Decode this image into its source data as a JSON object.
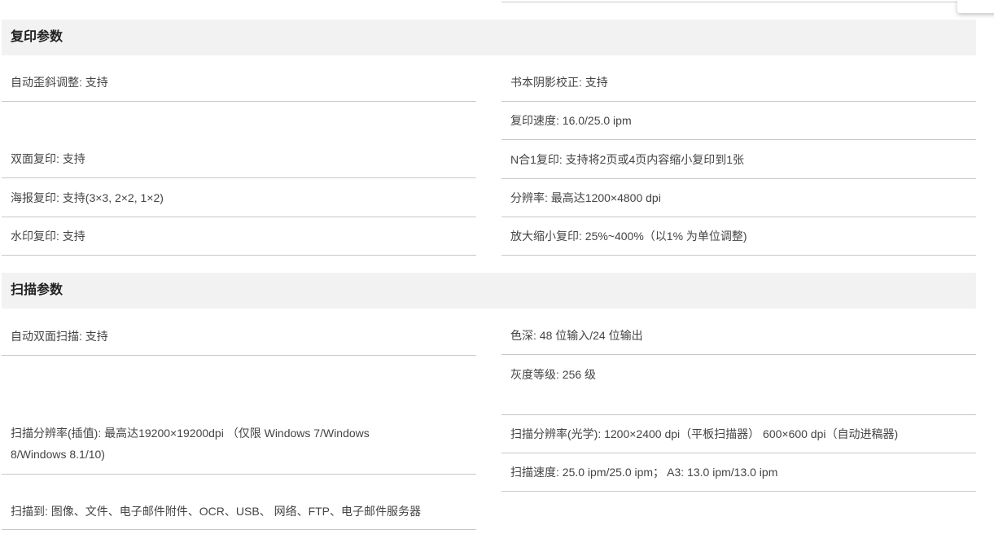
{
  "copy_section": {
    "title": "复印参数",
    "left": [
      "自动歪斜调整: 支持",
      "双面复印: 支持",
      "海报复印: 支持(3×3, 2×2, 1×2)",
      "水印复印: 支持"
    ],
    "right": [
      "书本阴影校正: 支持",
      "复印速度: 16.0/25.0 ipm",
      "N合1复印: 支持将2页或4页内容缩小复印到1张",
      "分辨率: 最高达1200×4800 dpi",
      "放大缩小复印: 25%~400%（以1% 为单位调整)"
    ]
  },
  "scan_section": {
    "title": "扫描参数",
    "left": [
      "自动双面扫描: 支持",
      "扫描分辨率(插值): 最高达19200×19200dpi （仅限 Windows 7/Windows 8/Windows 8.1/10)",
      "扫描到: 图像、文件、电子邮件附件、OCR、USB、 网络、FTP、电子邮件服务器"
    ],
    "right": [
      "色深: 48 位输入/24 位输出",
      "灰度等级: 256 级",
      "扫描分辨率(光学): 1200×2400 dpi（平板扫描器） 600×600 dpi（自动进稿器)",
      "扫描速度: 25.0 ipm/25.0 ipm； A3: 13.0 ipm/13.0 ipm"
    ]
  }
}
